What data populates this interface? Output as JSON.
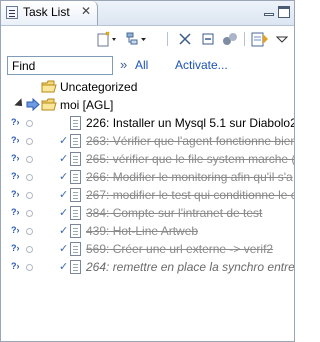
{
  "tab": {
    "title": "Task List",
    "close": "✕"
  },
  "filter": {
    "find_placeholder": "Find",
    "chevron": "»",
    "all_label": "All",
    "activate_label": "Activate..."
  },
  "categories": [
    {
      "label": "Uncategorized"
    },
    {
      "label": "moi  [AGL]"
    }
  ],
  "tasks": [
    {
      "text": "226: Installer un Mysql 5.1 sur Diabolo2",
      "state": "active"
    },
    {
      "text": "263: Vérifier que l'agent fonctionne bien",
      "state": "done"
    },
    {
      "text": "265: vérifier que le file system marche (e",
      "state": "done"
    },
    {
      "text": "266: Modifier le monitoring afin qu'il s'a",
      "state": "done"
    },
    {
      "text": "267: modifier le test qui conditionne le c",
      "state": "done"
    },
    {
      "text": "384: Compte sur l'intranet de test",
      "state": "done"
    },
    {
      "text": "439: Hot-Line Artweb",
      "state": "done"
    },
    {
      "text": "569: Créer une url externe -> verif2",
      "state": "done"
    },
    {
      "text": "264: remettre en place la synchro entre b",
      "state": "italic"
    }
  ],
  "icons": {
    "tab": "task-list-icon",
    "minimize": "minimize-icon",
    "maximize": "maximize-icon",
    "new_task": "new-task-icon",
    "categorize": "category-icon",
    "clear": "clear-icon",
    "collapse": "collapse-all-icon",
    "focus": "focus-icon",
    "sync": "synchronize-icon",
    "menu": "view-menu-icon"
  }
}
